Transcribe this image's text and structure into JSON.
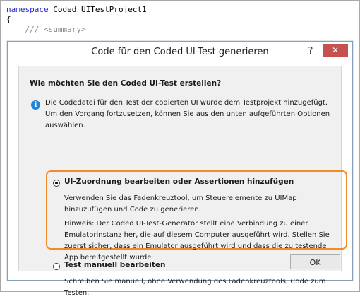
{
  "code": {
    "line1_keyword": "namespace",
    "line1_name": " Coded UITestProject1",
    "line2": "{",
    "line3": "    /// <summary>"
  },
  "dialog": {
    "title": "Code für den Coded UI-Test generieren",
    "help_label": "?",
    "close_label": "✕",
    "question": "Wie möchten Sie den Coded UI-Test erstellen?",
    "info": "Die Codedatei für den Test der codierten UI wurde dem Testprojekt hinzugefügt. Um den Vorgang fortzusetzen, können Sie aus den unten aufgeführten Optionen auswählen.",
    "option1": {
      "label": "UI-Zuordnung bearbeiten oder Assertionen hinzufügen",
      "desc1": "Verwenden Sie das Fadenkreuztool, um Steuerelemente zu UIMap hinzuzufügen und Code zu generieren.",
      "desc2": "Hinweis: Der Coded UI-Test-Generator stellt eine Verbindung zu einer Emulatorinstanz her, die auf diesem Computer ausgeführt wird. Stellen Sie zuerst sicher, dass ein Emulator ausgeführt wird und dass die zu testende App bereitgestellt wurde",
      "selected": true
    },
    "option2": {
      "label": "Test manuell bearbeiten",
      "desc": "Schreiben Sie manuell, ohne Verwendung des Fadenkreuztools, Code zum Testen.",
      "selected": false
    },
    "ok_label": "OK"
  },
  "colors": {
    "highlight": "#f28c28",
    "keyword": "#1f1fd1",
    "close": "#c75050",
    "info_icon": "#1e86d9"
  }
}
